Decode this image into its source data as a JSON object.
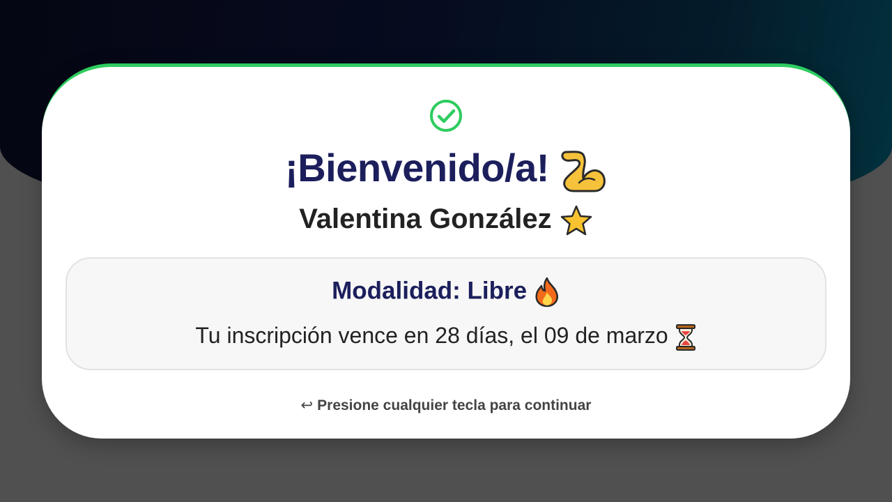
{
  "card": {
    "status_icon": "check-circle-icon",
    "welcome_text": "¡Bienvenido/a!",
    "welcome_emoji": "flexed-biceps-icon",
    "user_name": "Valentina González",
    "name_emoji": "star-icon"
  },
  "membership": {
    "modalidad_text": "Modalidad: Libre",
    "modalidad_emoji": "fire-icon",
    "expiry_text": "Tu inscripción vence en 28 días, el 09 de marzo",
    "expiry_emoji": "hourglass-icon"
  },
  "footer": {
    "arrow_icon": "enter-arrow-icon",
    "arrow_glyph": "↩",
    "hint_text": "Presione cualquier tecla para continuar"
  },
  "colors": {
    "accent_green": "#2ecc5f",
    "title_navy": "#1c1f5c",
    "text_dark": "#222222",
    "background_gray": "#505050"
  }
}
